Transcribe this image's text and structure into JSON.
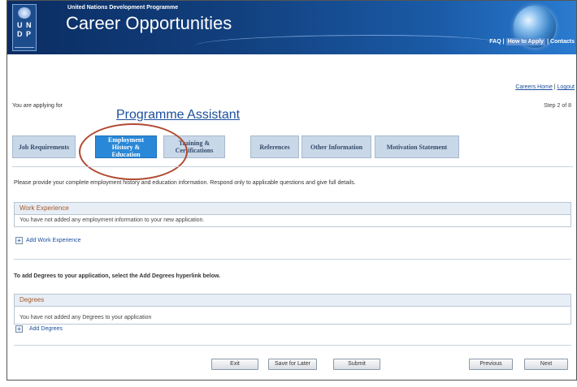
{
  "header": {
    "org_line": "United Nations Development Programme",
    "title": "Career Opportunities",
    "logo_letters": [
      "U",
      "N",
      "D",
      "P"
    ],
    "top_links": [
      "FAQ",
      "How to Apply",
      "Contacts"
    ],
    "colors": {
      "header_dark": "#0b2d63",
      "header_light": "#2a7bd0",
      "link": "#1b4f9c",
      "tab_active": "#2a88d8",
      "tab": "#c9d8e8",
      "section_head_text": "#a45a2a",
      "highlight_circle": "#b04a30"
    }
  },
  "career_links": {
    "home": "Careers Home",
    "sep": "|",
    "logout": "Logout"
  },
  "applying": {
    "label": "You are applying for",
    "job_title": "Programme Assistant",
    "step": "Step 2 of 8"
  },
  "tabs": [
    {
      "label": "Job Requirements",
      "active": false
    },
    {
      "label": "Employment History & Education",
      "active": true
    },
    {
      "label": "Training & Certifications",
      "active": false
    },
    {
      "label": "References",
      "active": false
    },
    {
      "label": "Other Information",
      "active": false
    },
    {
      "label": "Motivation Statement",
      "active": false
    }
  ],
  "instructions": "Please provide your complete employment history and education information. Respond only to applicable questions and give full details.",
  "work_experience": {
    "heading": "Work Experience",
    "empty_message": "You have not added any employment information to your new application.",
    "add_link": "Add Work Experience"
  },
  "degrees_intro": "To add Degrees to your application, select the Add Degrees hyperlink below.",
  "degrees": {
    "heading": "Degrees",
    "empty_message": "You have not added any Degrees to your application",
    "add_link": "Add Degrees"
  },
  "buttons": {
    "exit": "Exit",
    "save_later": "Save for Later",
    "submit": "Submit",
    "previous": "Previous",
    "next": "Next"
  },
  "icons": {
    "logo": "un-emblem-icon",
    "globe": "globe-icon",
    "plus": "plus-icon"
  }
}
